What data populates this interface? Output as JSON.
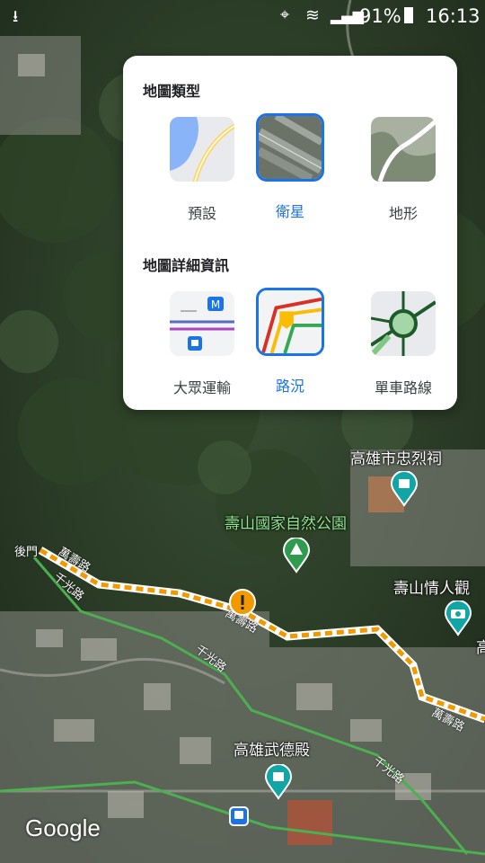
{
  "status": {
    "battery": "91%",
    "time": "16:13"
  },
  "panel": {
    "map_type_title": "地圖類型",
    "map_types": [
      {
        "label": "預設",
        "selected": false
      },
      {
        "label": "衛星",
        "selected": true
      },
      {
        "label": "地形",
        "selected": false
      }
    ],
    "details_title": "地圖詳細資訊",
    "details": [
      {
        "label": "大眾運輸",
        "selected": false
      },
      {
        "label": "路況",
        "selected": true
      },
      {
        "label": "單車路線",
        "selected": false
      }
    ]
  },
  "map": {
    "labels": {
      "zhonglie": "高雄市忠烈祠",
      "park": "壽山國家自然公園",
      "lovers": "壽山情人觀",
      "wude": "高雄武德殿",
      "houmen": "後門",
      "road1": "萬壽路",
      "road2": "千光路",
      "road3": "千光路",
      "road4": "萬壽路",
      "road5": "千光路",
      "road6": "萬壽路",
      "edge_char": "高"
    },
    "logo": "Google"
  },
  "colors": {
    "accent": "#1a73e8",
    "traffic": "#f29900",
    "bike_route": "#4caf50"
  }
}
